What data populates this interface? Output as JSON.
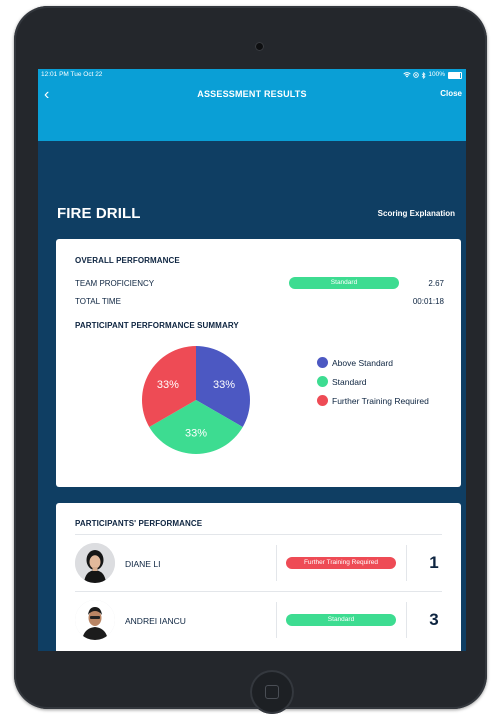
{
  "status": {
    "time": "12:01 PM  Tue Oct 22",
    "battery": "100%",
    "icons": [
      "wifi-icon",
      "location-icon",
      "bluetooth-icon",
      "battery-icon"
    ]
  },
  "nav": {
    "title": "ASSESSMENT RESULTS",
    "close_label": "Close",
    "back_icon": "‹"
  },
  "header": {
    "title": "FIRE DRILL",
    "scoring_link": "Scoring Explanation"
  },
  "overall": {
    "heading": "OVERALL PERFORMANCE",
    "team_label": "TEAM PROFICIENCY",
    "team_badge": "Standard",
    "team_value": "2.67",
    "time_label": "TOTAL TIME",
    "time_value": "00:01:18",
    "summary_heading": "PARTICIPANT PERFORMANCE SUMMARY"
  },
  "chart_data": {
    "type": "pie",
    "categories": [
      "Above Standard",
      "Standard",
      "Further Training Required"
    ],
    "values": [
      33,
      33,
      33
    ],
    "labels": [
      "33%",
      "33%",
      "33%"
    ],
    "colors": [
      "#4c58c2",
      "#3ddc91",
      "#ee4b55"
    ],
    "legend_placement": "right"
  },
  "participants": {
    "heading": "PARTICIPANTS' PERFORMANCE",
    "rows": [
      {
        "name": "DIANE LI",
        "badge": "Further Training Required",
        "badge_color": "#ee4b55",
        "score": "1"
      },
      {
        "name": "ANDREI IANCU",
        "badge": "Standard",
        "badge_color": "#3ddc91",
        "score": "3"
      }
    ]
  }
}
